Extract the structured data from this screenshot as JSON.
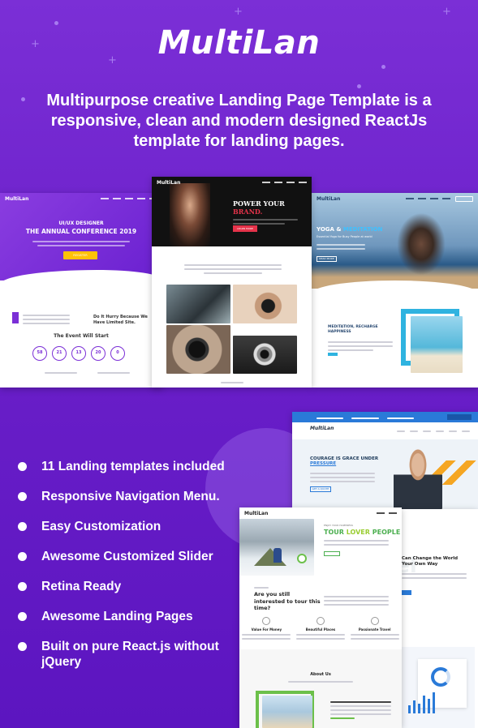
{
  "brand": {
    "logo": "MultiLan"
  },
  "headline": "Multipurpose creative Landing Page Template is a responsive, clean and modern designed ReactJs template for landing pages.",
  "previews": {
    "conference": {
      "logo": "MultiLan",
      "eyebrow": "UI/UX DESIGNER",
      "title": "THE ANNUAL CONFERENCE 2019",
      "button": "REGISTER",
      "event_heading": "The Event Will Start",
      "hurry_text": "Do It Hurry Because We Have Limited Site.",
      "countdown": [
        "58",
        "21",
        "13",
        "20",
        "0"
      ]
    },
    "photographer": {
      "logo": "MultiLan",
      "title": "POWER YOUR",
      "title_accent": "BRAND.",
      "button": "LEARN MORE"
    },
    "yoga": {
      "logo": "MultiLan",
      "title": "YOGA &",
      "title_accent": "MEDITATION",
      "subtitle": "Essential Yoga for Busy People at world",
      "button": "READ MORE",
      "section": "MEDITATION, RECHARGE HAPPINESS"
    },
    "business": {
      "logo": "MultiLan",
      "title": "COURAGE IS GRACE UNDER",
      "title_accent": "PRESSURE",
      "button": "GET A QUOTE"
    },
    "travel": {
      "logo": "MultiLan",
      "eyebrow": "ENJOY YOUR HAPPINESS",
      "title": "TOUR",
      "title_accent": "LOVER",
      "title_end": "PEOPLE",
      "question": "Are you still interested to tour this time?",
      "features": [
        "Value For Money",
        "Beautiful Places",
        "Passionate Travel"
      ],
      "about": "About Us",
      "bg_word": "Travel",
      "side_title": "Can Change the World Your Own Way"
    }
  },
  "features": [
    "11 Landing templates included",
    "Responsive Navigation Menu.",
    "Easy Customization",
    "Awesome Customized Slider",
    "Retina Ready",
    "Awesome Landing Pages",
    "Built on pure React.js without jQuery"
  ]
}
